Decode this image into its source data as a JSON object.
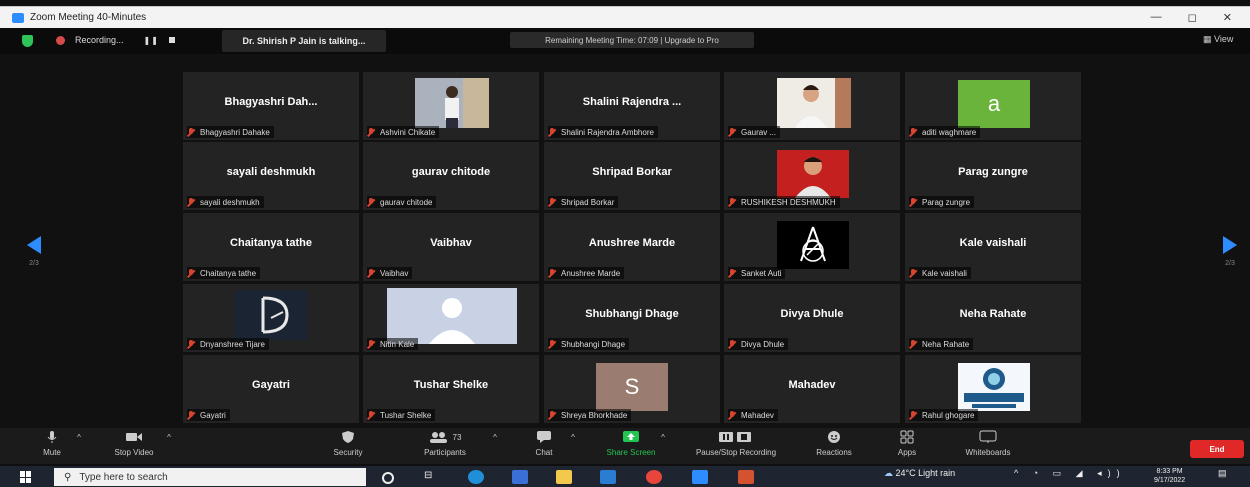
{
  "window": {
    "title": "Zoom Meeting 40-Minutes",
    "minimize": "—",
    "restore": "◻",
    "close": "✕"
  },
  "topbar": {
    "recording_label": "Recording...",
    "pause": "❚❚",
    "talking": "Dr. Shirish P Jain is talking...",
    "remaining": "Remaining Meeting Time: 07:09 | Upgrade to Pro",
    "view_label": "View"
  },
  "pager": {
    "left_label": "2/3",
    "right_label": "2/3"
  },
  "participants": [
    {
      "big": "Bhagyashri  Dah...",
      "small": "Bhagyashri Dahake",
      "photo": null
    },
    {
      "big": "",
      "small": "Ashvini Chikate",
      "photo": "person-standing"
    },
    {
      "big": "Shalini  Rajendra ...",
      "small": "Shalini Rajendra Ambhore",
      "photo": null
    },
    {
      "big": "",
      "small": "Gaurav ...",
      "photo": "person-portrait"
    },
    {
      "big": "",
      "small": "aditi waghmare",
      "photo": "letter-a",
      "letter": "a"
    },
    {
      "big": "sayali deshmukh",
      "small": "sayali deshmukh",
      "photo": null
    },
    {
      "big": "gaurav chitode",
      "small": "gaurav chitode",
      "photo": null
    },
    {
      "big": "Shripad Borkar",
      "small": "Shripad Borkar",
      "photo": null
    },
    {
      "big": "",
      "small": "RUSHIKESH DESHMUKH",
      "photo": "person-red"
    },
    {
      "big": "Parag zungre",
      "small": "Parag zungre",
      "photo": null
    },
    {
      "big": "Chaitanya tathe",
      "small": "Chaitanya tathe",
      "photo": null
    },
    {
      "big": "Vaibhav",
      "small": "Vaibhav",
      "photo": null
    },
    {
      "big": "Anushree  Marde",
      "small": "Anushree  Marde",
      "photo": null
    },
    {
      "big": "",
      "small": "Sanket Auti",
      "photo": "logo-as"
    },
    {
      "big": "Kale vaishali",
      "small": "Kale vaishali",
      "photo": null
    },
    {
      "big": "",
      "small": "Dnyanshree Tijare",
      "photo": "logo-d"
    },
    {
      "big": "",
      "small": "Nitin Kale",
      "photo": "default-avatar"
    },
    {
      "big": "Shubhangi Dhage",
      "small": "Shubhangi Dhage",
      "photo": null
    },
    {
      "big": "Divya Dhule",
      "small": "Divya Dhule",
      "photo": null
    },
    {
      "big": "Neha Rahate",
      "small": "Neha Rahate",
      "photo": null
    },
    {
      "big": "Gayatri",
      "small": "Gayatri",
      "photo": null
    },
    {
      "big": "Tushar Shelke",
      "small": "Tushar Shelke",
      "photo": null
    },
    {
      "big": "",
      "small": "Shreya Bhorkhade",
      "photo": "letter-s",
      "letter": "S"
    },
    {
      "big": "Mahadev",
      "small": "Mahadev",
      "photo": null
    },
    {
      "big": "",
      "small": "Rahul ghogare",
      "photo": "logo-rajarshi",
      "logo_text": "Rajarshi Shahu"
    }
  ],
  "toolbar": {
    "mute": "Mute",
    "stop_video": "Stop Video",
    "security": "Security",
    "participants": "Participants",
    "participant_count": "73",
    "chat": "Chat",
    "share_screen": "Share Screen",
    "recording": "Pause/Stop Recording",
    "reactions": "Reactions",
    "apps": "Apps",
    "whiteboards": "Whiteboards",
    "end": "End"
  },
  "taskbar": {
    "search_placeholder": "Type here to search",
    "weather": "24°C  Light rain",
    "time": "8:33 PM",
    "date": "9/17/2022"
  },
  "colors": {
    "accent": "#2d8cff",
    "end": "#e02828",
    "share": "#23c552",
    "mic_muted": "#d9442f"
  }
}
